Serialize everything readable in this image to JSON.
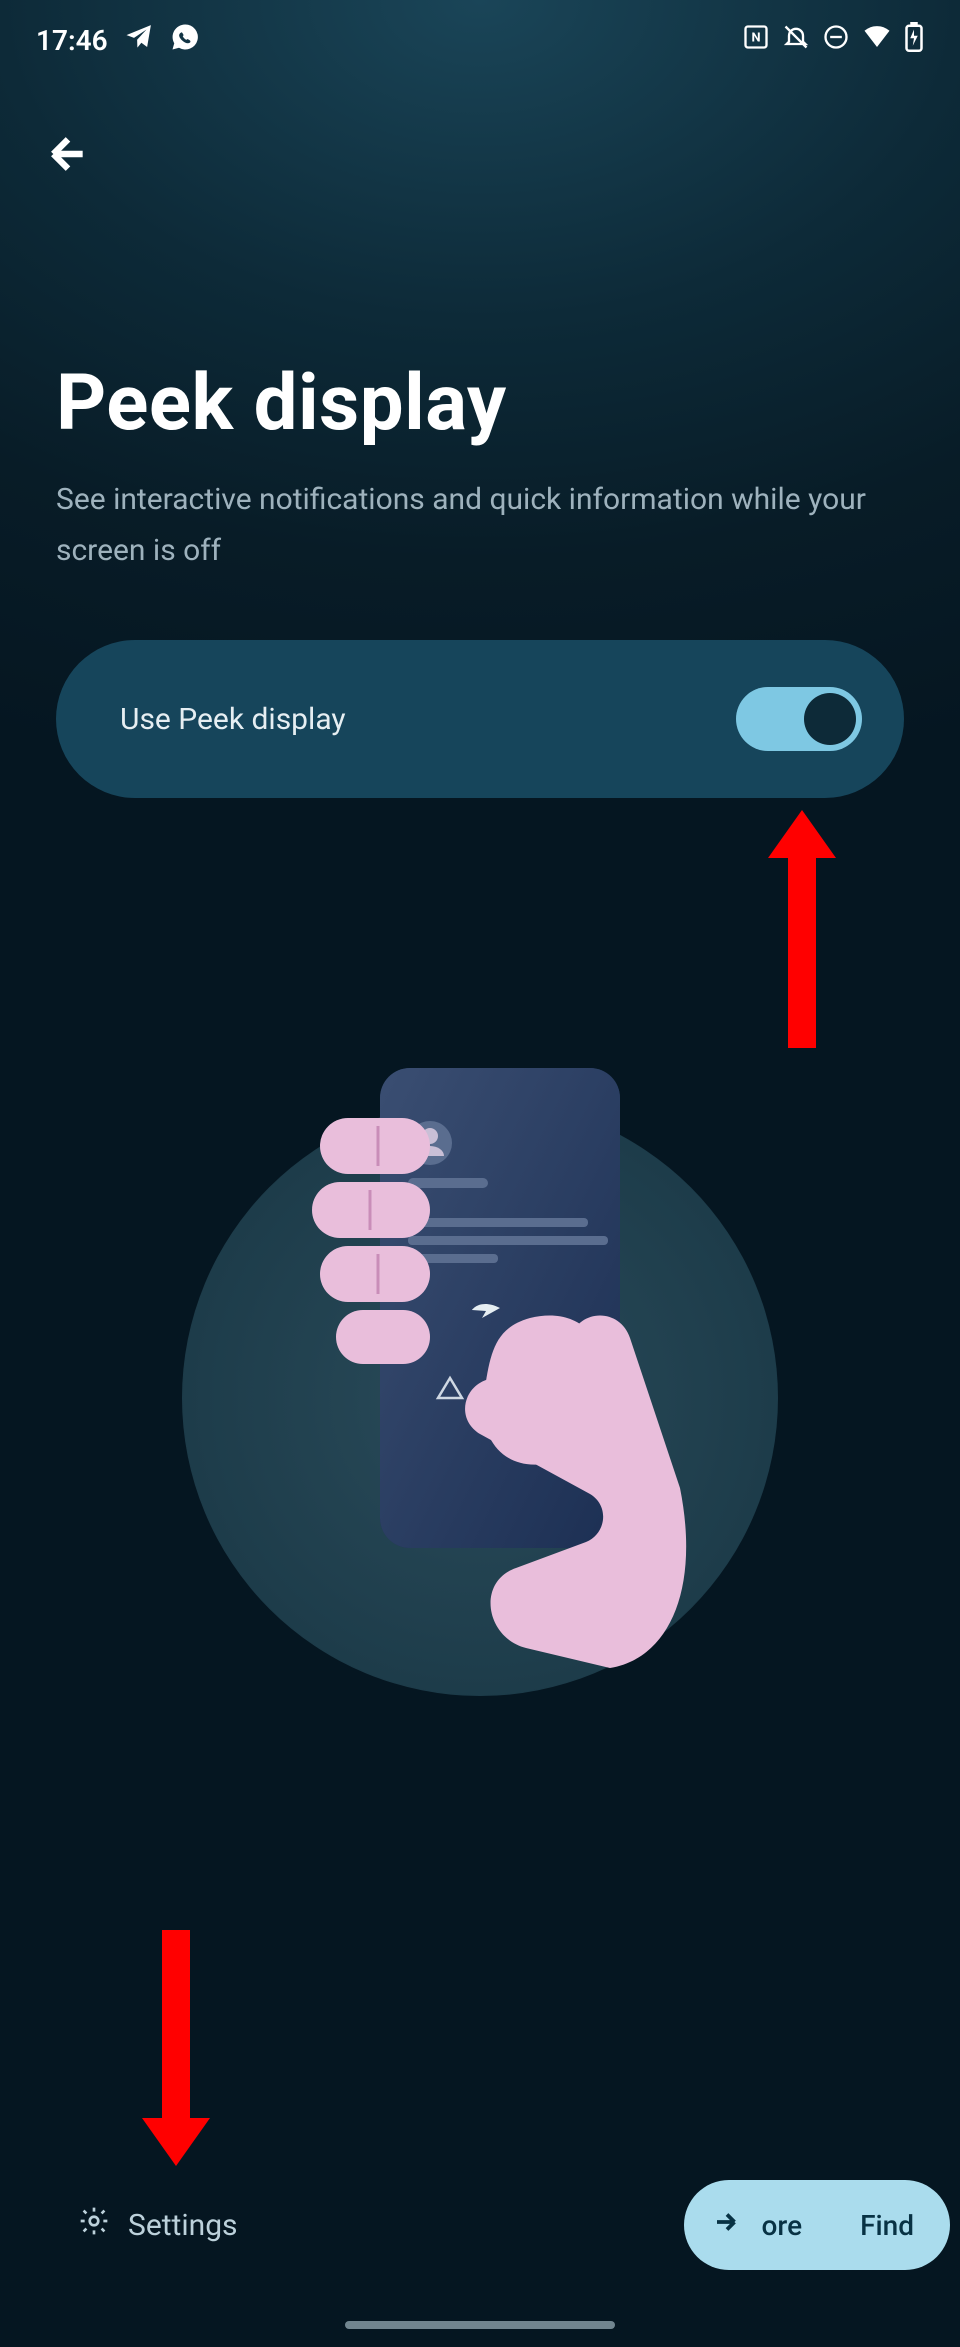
{
  "status": {
    "time": "17:46",
    "app_icons": [
      "telegram",
      "whatsapp"
    ],
    "system_icons": [
      "nfc",
      "dnd-muted",
      "minus-circle",
      "wifi",
      "battery-charging"
    ]
  },
  "page": {
    "title": "Peek display",
    "subtitle": "See interactive notifications and quick information while your screen is off",
    "toggle_label": "Use Peek display",
    "toggle_on": true
  },
  "bottom": {
    "settings_label": "Settings",
    "pill_part1": "ore",
    "pill_part2": "Find"
  }
}
